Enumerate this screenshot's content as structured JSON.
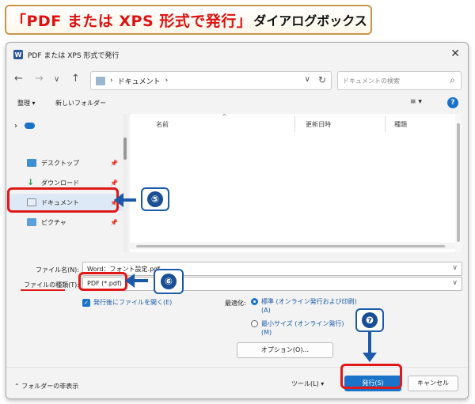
{
  "banner": {
    "title": "「PDF または XPS 形式で発行」",
    "suffix": "ダイアログボックス"
  },
  "dialog": {
    "app_icon": "W",
    "title": "PDF または XPS 形式で発行",
    "close_icon": "✕",
    "nav": {
      "back": "←",
      "forward": "→",
      "recent": "∨",
      "up": "↑"
    },
    "address": {
      "path": "ドキュメント",
      "sep1": "›",
      "sep2": "›",
      "dropdown": "∨",
      "refresh": "↻"
    },
    "search": {
      "placeholder": "ドキュメントの検索",
      "icon": "⌕"
    },
    "toolbar": {
      "organize": "整理 ▾",
      "new_folder": "新しいフォルダー",
      "view": "≡ ▾",
      "help": "?"
    },
    "sidebar": {
      "items": [
        {
          "label": "",
          "chevron": "›"
        },
        {
          "label": "デスクトップ",
          "pin": "📌"
        },
        {
          "label": "ダウンロード",
          "pin": "📌"
        },
        {
          "label": "ドキュメント",
          "pin": "📌"
        },
        {
          "label": "ピクチャ",
          "pin": "📌"
        }
      ]
    },
    "file_list": {
      "columns": [
        "名前",
        "更新日時",
        "種類"
      ],
      "sort_icon": "^"
    },
    "form": {
      "filename_label": "ファイル名(N):",
      "filename_value": "Word：フォント設定.pdf",
      "filetype_label": "ファイルの種類(T):",
      "filetype_value": "PDF (*.pdf)",
      "open_after": "発行後にファイルを開く(E)",
      "optimize_label": "最適化:",
      "opt_standard": "標準 (オンライン発行および印刷)(A)",
      "opt_min": "最小サイズ (オンライン発行)(M)",
      "options_button": "オプション(O)...",
      "check_mark": "✓",
      "dropdown": "∨"
    },
    "footer": {
      "hide_folders": "⌃ フォルダーの非表示",
      "tools": "ツール(L) ▾",
      "publish": "発行(S)",
      "cancel": "キャンセル"
    }
  },
  "annotations": {
    "step5": "⑤",
    "step6": "⑥",
    "step7": "❼"
  }
}
